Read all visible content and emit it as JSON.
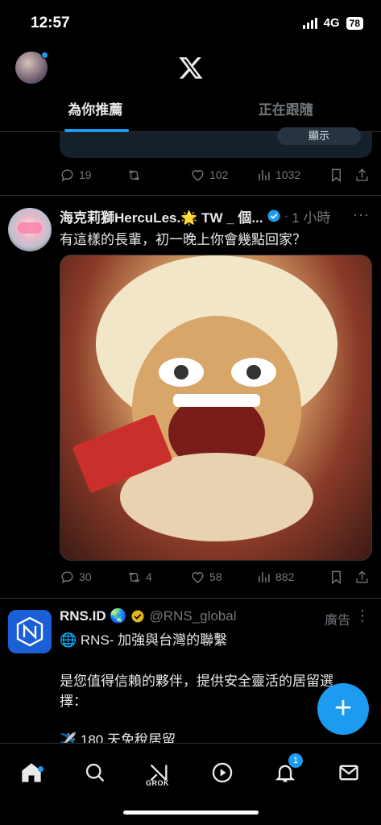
{
  "status_bar": {
    "time": "12:57",
    "network": "4G",
    "battery": "78"
  },
  "header": {
    "tabs": [
      {
        "label": "為你推薦",
        "active": true
      },
      {
        "label": "正在跟隨",
        "active": false
      }
    ]
  },
  "prev_tweet": {
    "pill_text": "顯示",
    "stats": {
      "replies": "19",
      "reposts": "",
      "likes": "102",
      "views": "1032"
    }
  },
  "tweet": {
    "author": "海克莉獅HercuLes.🌟 TW _ 個...",
    "time": "1 小時",
    "text": "有這樣的長輩，初一晚上你會幾點回家？",
    "stats": {
      "replies": "30",
      "reposts": "4",
      "likes": "58",
      "views": "882"
    }
  },
  "ad": {
    "author": "RNS.ID 🌏",
    "handle": "@RNS_global",
    "label": "廣告",
    "lines": [
      "🌐 RNS- 加強與台灣的聯繫",
      "是您值得信賴的夥伴，提供安全靈活的居留選",
      "擇：",
      "✈️ 180 天免稅居留"
    ]
  },
  "bottom_nav": {
    "grok_label": "GROK",
    "notification_count": "1"
  },
  "colors": {
    "accent": "#1d9bf0",
    "muted": "#71767b",
    "divider": "#2f3336"
  }
}
